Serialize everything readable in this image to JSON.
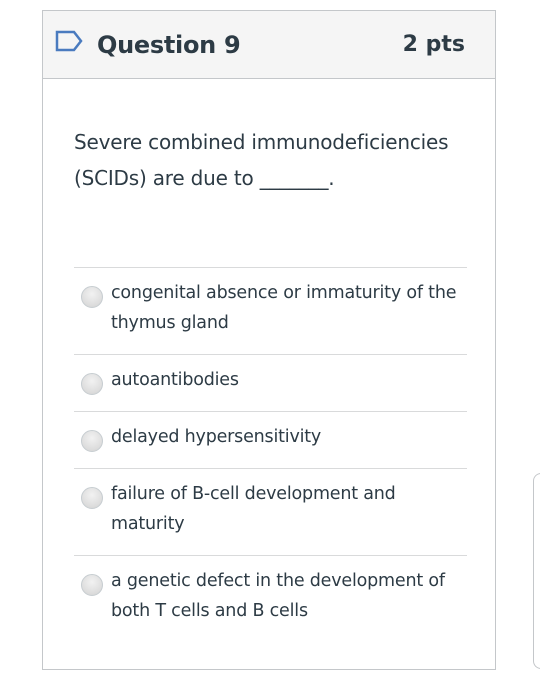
{
  "question": {
    "title": "Question 9",
    "points": "2 pts",
    "text": "Severe combined immunodeficiencies (SCIDs) are due to _______."
  },
  "answers": [
    {
      "label": "congenital absence or immaturity of the thymus gland"
    },
    {
      "label": "autoantibodies"
    },
    {
      "label": "delayed hypersensitivity"
    },
    {
      "label": "failure of B-cell development and maturity"
    },
    {
      "label": "a genetic defect in the development of both T cells and B cells"
    }
  ],
  "icons": {
    "flag": "bookmark-flag-icon"
  },
  "colors": {
    "text": "#2d3b45",
    "flag": "#4a7bbf",
    "header_bg": "#f5f5f5",
    "border": "#c4c7ca"
  }
}
